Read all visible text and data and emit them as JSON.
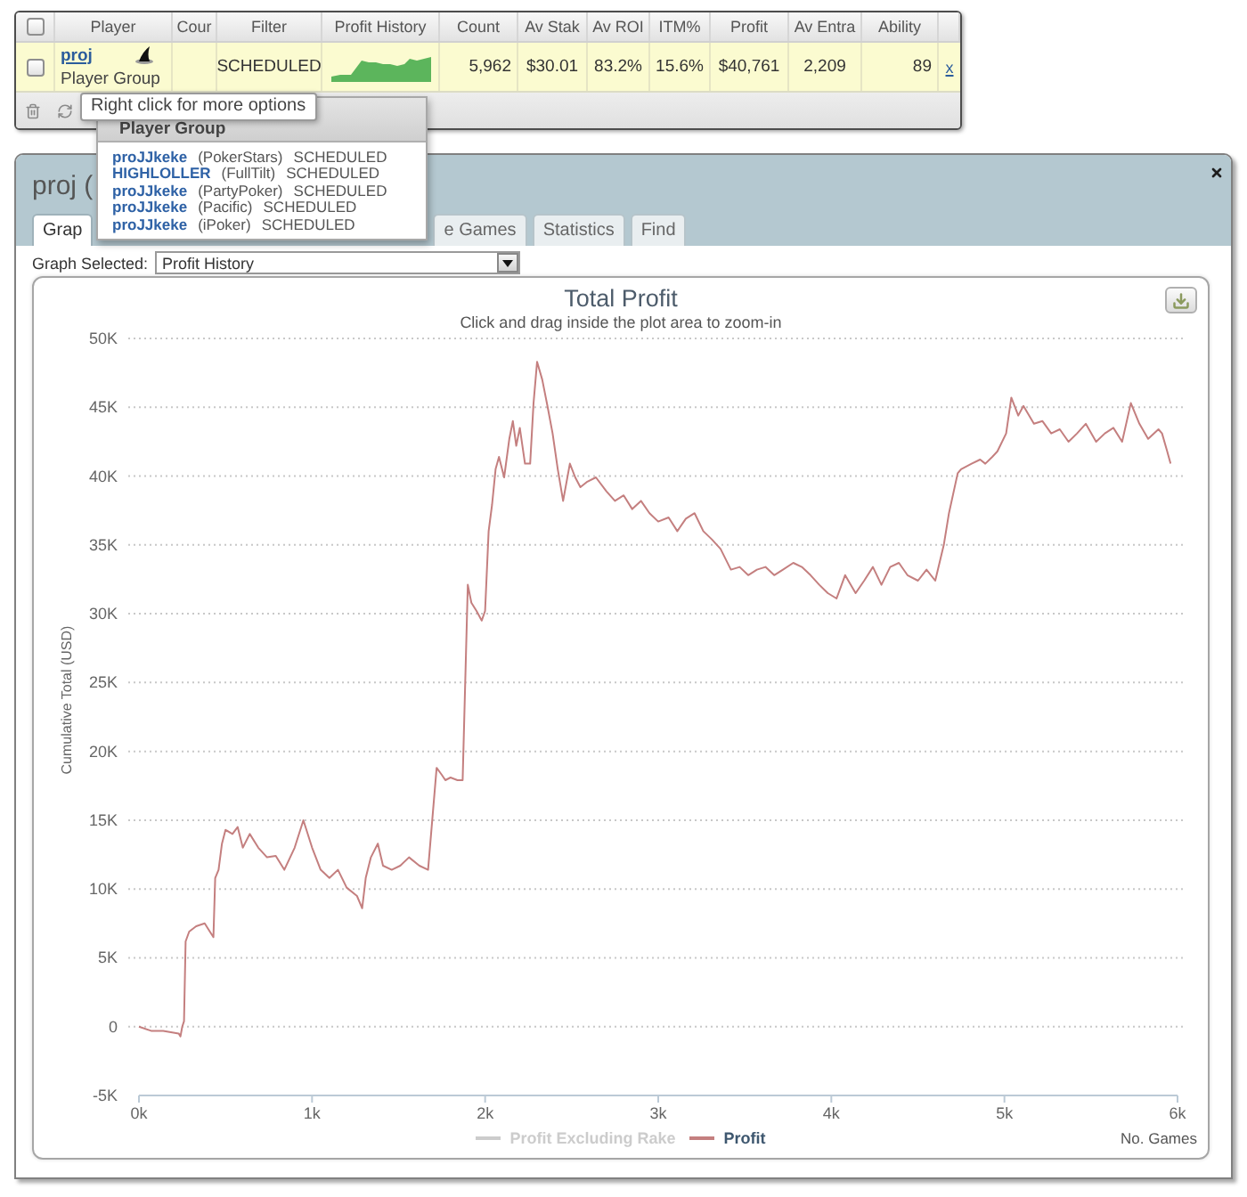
{
  "players_table": {
    "select_all": {
      "checked": false
    },
    "columns": [
      "Player",
      "Cour",
      "Filter",
      "Profit History",
      "Count",
      "Av Stak",
      "Av ROI",
      "ITM%",
      "Profit",
      "Av Entra",
      "Ability"
    ],
    "rows": [
      {
        "checked": false,
        "player": "proj",
        "group": "Player Group",
        "filter": "SCHEDULED",
        "count": "5,962",
        "av_stak": "$30.01",
        "av_roi": "83.2%",
        "itm_pct": "15.6%",
        "profit": "$40,761",
        "av_entra": "2,209",
        "ability": "89",
        "remove": "x"
      }
    ]
  },
  "tooltip": {
    "text": "Right click for more options"
  },
  "group_popup": {
    "title": "Player Group",
    "members": [
      {
        "name": "proJJkeke",
        "site": "(PokerStars)",
        "status": "SCHEDULED"
      },
      {
        "name": "HIGHLOLLER",
        "site": "(FullTilt)",
        "status": "SCHEDULED"
      },
      {
        "name": "proJJkeke",
        "site": "(PartyPoker)",
        "status": "SCHEDULED"
      },
      {
        "name": "proJJkeke",
        "site": "(Pacific)",
        "status": "SCHEDULED"
      },
      {
        "name": "proJJkeke",
        "site": "(iPoker)",
        "status": "SCHEDULED"
      }
    ]
  },
  "window": {
    "title": "proj (",
    "tabs": [
      {
        "label": "Grap",
        "selected": true
      },
      {
        "label": "e Games",
        "selected": false
      },
      {
        "label": "Statistics",
        "selected": false
      },
      {
        "label": "Find",
        "selected": false
      }
    ]
  },
  "graph_select": {
    "label": "Graph Selected:",
    "value": "Profit History"
  },
  "chart": {
    "subtitle": "Click and drag inside the plot area to zoom-in",
    "legend_hidden": [
      {
        "label": "Profit Excluding Rake",
        "visible": false
      }
    ],
    "chart_data": {
      "type": "line",
      "title": "Total Profit",
      "xlabel": "No. Games",
      "ylabel": "Cumulative Total (USD)",
      "grid": true,
      "xlim": [
        0,
        6000
      ],
      "ylim": [
        -5000,
        50000
      ],
      "xticks": [
        {
          "value": 0,
          "label": "0k"
        },
        {
          "value": 1000,
          "label": "1k"
        },
        {
          "value": 2000,
          "label": "2k"
        },
        {
          "value": 3000,
          "label": "3k"
        },
        {
          "value": 4000,
          "label": "4k"
        },
        {
          "value": 5000,
          "label": "5k"
        },
        {
          "value": 6000,
          "label": "6k"
        }
      ],
      "yticks": [
        {
          "value": -5000,
          "label": "-5K"
        },
        {
          "value": 0,
          "label": "0"
        },
        {
          "value": 5000,
          "label": "5K"
        },
        {
          "value": 10000,
          "label": "10K"
        },
        {
          "value": 15000,
          "label": "15K"
        },
        {
          "value": 20000,
          "label": "20K"
        },
        {
          "value": 25000,
          "label": "25K"
        },
        {
          "value": 30000,
          "label": "30K"
        },
        {
          "value": 35000,
          "label": "35K"
        },
        {
          "value": 40000,
          "label": "40K"
        },
        {
          "value": 45000,
          "label": "45K"
        },
        {
          "value": 50000,
          "label": "50K"
        }
      ],
      "x": [
        0,
        70,
        140,
        230,
        240,
        250,
        260,
        270,
        290,
        330,
        380,
        410,
        430,
        440,
        460,
        480,
        500,
        540,
        570,
        600,
        640,
        690,
        740,
        790,
        840,
        900,
        950,
        1000,
        1050,
        1100,
        1150,
        1200,
        1260,
        1290,
        1310,
        1340,
        1380,
        1410,
        1460,
        1510,
        1560,
        1620,
        1670,
        1720,
        1750,
        1770,
        1800,
        1840,
        1870,
        1900,
        1920,
        1950,
        1980,
        2000,
        2020,
        2040,
        2060,
        2080,
        2110,
        2140,
        2160,
        2180,
        2200,
        2230,
        2260,
        2280,
        2300,
        2330,
        2360,
        2390,
        2420,
        2450,
        2490,
        2520,
        2550,
        2590,
        2640,
        2700,
        2750,
        2800,
        2850,
        2900,
        2950,
        3000,
        3060,
        3110,
        3160,
        3210,
        3260,
        3310,
        3360,
        3420,
        3470,
        3520,
        3570,
        3620,
        3670,
        3720,
        3780,
        3830,
        3880,
        3930,
        3980,
        4030,
        4080,
        4140,
        4190,
        4240,
        4290,
        4340,
        4390,
        4440,
        4500,
        4550,
        4600,
        4650,
        4680,
        4730,
        4750,
        4810,
        4860,
        4890,
        4930,
        4960,
        5010,
        5040,
        5080,
        5110,
        5170,
        5220,
        5270,
        5320,
        5370,
        5420,
        5470,
        5530,
        5580,
        5630,
        5680,
        5730,
        5780,
        5830,
        5890,
        5910,
        5940,
        5960
      ],
      "series": [
        {
          "name": "Profit",
          "color": "#c47f7f",
          "values": [
            0,
            -300,
            -300,
            -500,
            -700,
            0,
            400,
            6200,
            6900,
            7300,
            7500,
            6900,
            6500,
            10800,
            11400,
            13300,
            14300,
            14000,
            14500,
            13000,
            14000,
            13000,
            12300,
            12400,
            11400,
            13000,
            15000,
            13000,
            11400,
            10800,
            11400,
            10100,
            9500,
            8600,
            10800,
            12300,
            13300,
            11700,
            11400,
            11700,
            12300,
            11700,
            11400,
            18800,
            18300,
            17900,
            18100,
            17900,
            17900,
            32100,
            30800,
            30200,
            29500,
            30200,
            36000,
            37900,
            40500,
            41400,
            39900,
            42700,
            44000,
            42200,
            43500,
            40900,
            40900,
            45300,
            48300,
            47000,
            45100,
            43100,
            40500,
            38200,
            40900,
            39900,
            39200,
            39600,
            39900,
            38900,
            38200,
            38600,
            37600,
            38200,
            37300,
            36700,
            37000,
            36000,
            36900,
            37300,
            36000,
            35400,
            34700,
            33200,
            33400,
            32800,
            33200,
            33400,
            32800,
            33200,
            33700,
            33400,
            32800,
            32100,
            31500,
            31100,
            32800,
            31500,
            32400,
            33400,
            32100,
            33400,
            33700,
            32800,
            32400,
            33200,
            32400,
            35000,
            37300,
            40200,
            40500,
            40900,
            41200,
            40900,
            41400,
            41800,
            43100,
            45700,
            44400,
            45100,
            43800,
            44000,
            43100,
            43400,
            42500,
            43100,
            43800,
            42500,
            43100,
            43500,
            42500,
            45300,
            43800,
            42700,
            43400,
            43100,
            41800,
            40900
          ]
        }
      ]
    }
  }
}
